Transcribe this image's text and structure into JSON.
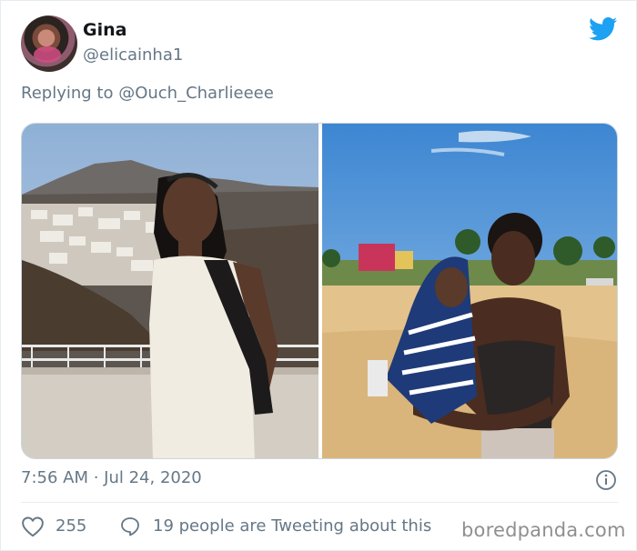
{
  "tweet": {
    "author": {
      "display_name": "Gina",
      "handle": "@elicainha1"
    },
    "reply": {
      "prefix": "Replying to ",
      "mention": "@Ouch_Charlieeee"
    },
    "timestamp": "7:56 AM · Jul 24, 2020",
    "likes": "255",
    "conversation": "19 people are Tweeting about this"
  },
  "icons": {
    "brand": "twitter-bird-icon",
    "info": "info-icon",
    "like": "heart-icon",
    "reply": "speech-bubble-icon"
  },
  "colors": {
    "twitter_blue": "#1da1f2",
    "secondary_text": "#657786",
    "like_accent": "#e0245e"
  },
  "watermark": "boredpanda.com"
}
